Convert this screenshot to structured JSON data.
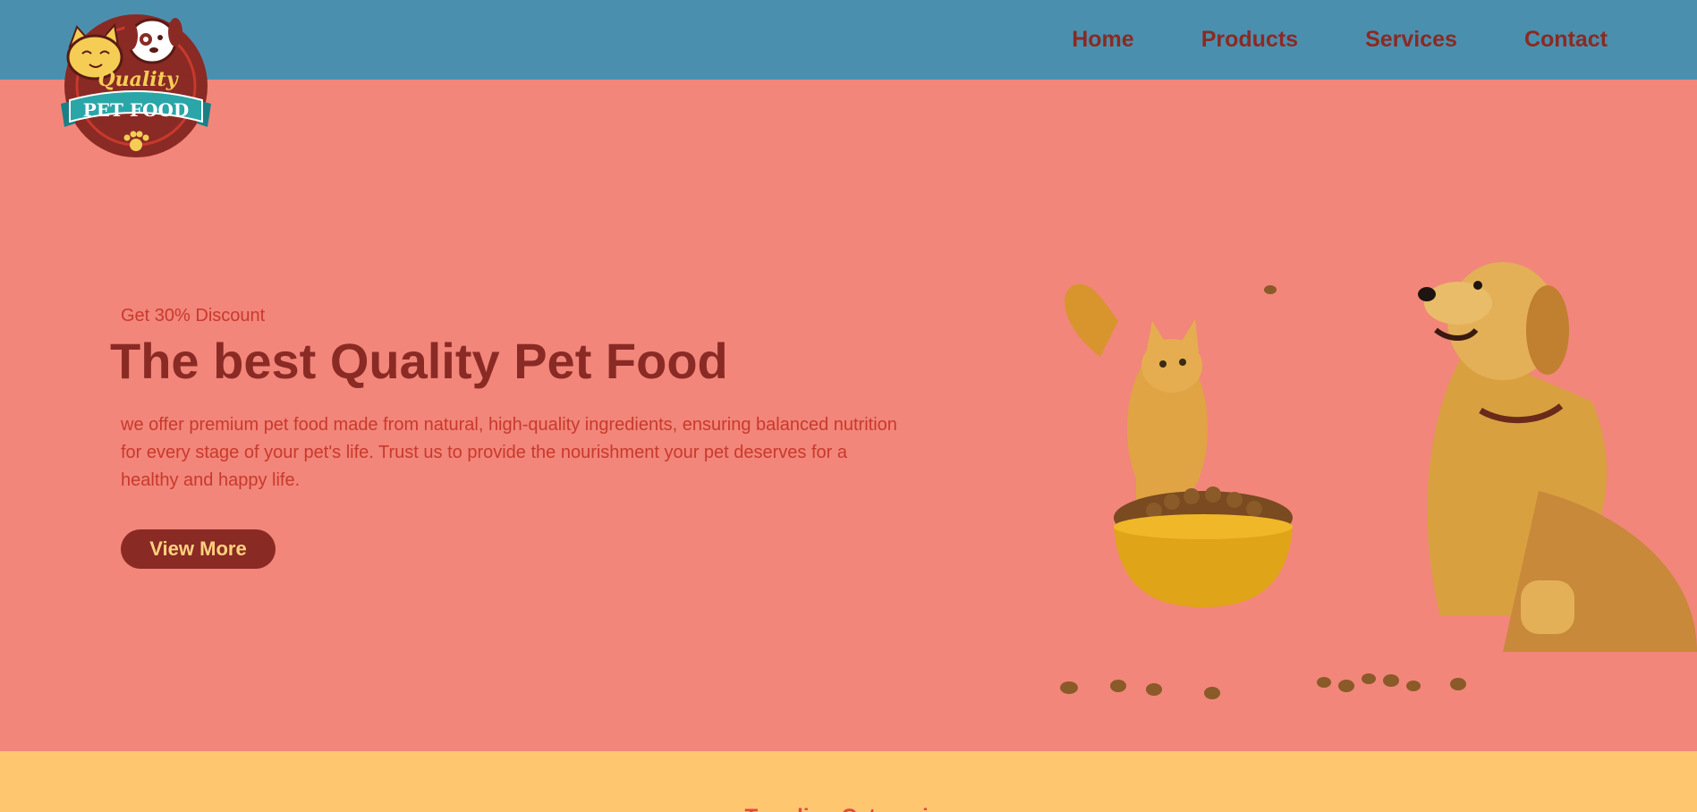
{
  "nav": {
    "logo_text_top": "Quality",
    "logo_text_banner": "PET FOOD",
    "links": [
      "Home",
      "Products",
      "Services",
      "Contact"
    ]
  },
  "hero": {
    "discount": "Get 30% Discount",
    "headline": "The best Quality Pet Food",
    "description": "we offer premium pet food made from natural, high-quality ingredients, ensuring balanced nutrition for every stage of your pet's life. Trust us to provide the nourishment your pet deserves for a healthy and happy life.",
    "cta_label": "View More"
  },
  "trending": {
    "title": "Trending Categories"
  },
  "colors": {
    "nav_bg": "#4a90ae",
    "hero_bg": "#f2867a",
    "accent_dark": "#8a2a24",
    "accent_red": "#c9392d",
    "button_text": "#ffd27d",
    "section_bg": "#ffc670"
  }
}
